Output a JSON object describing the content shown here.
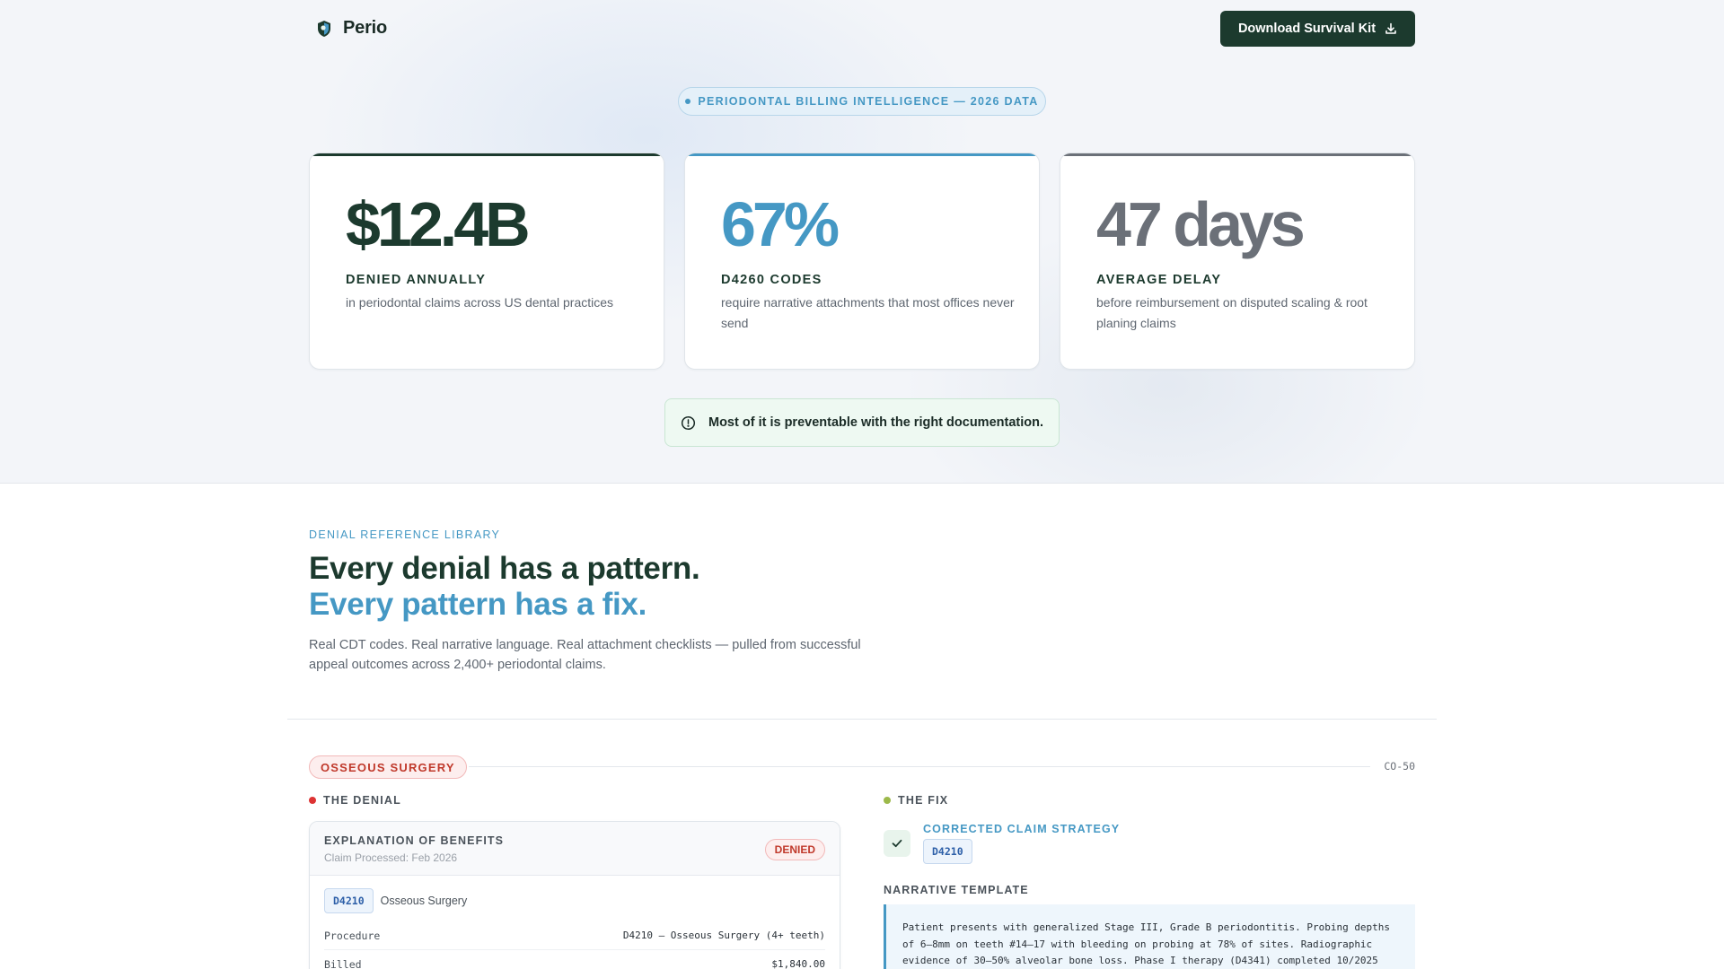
{
  "nav": {
    "brand": "Perio",
    "cta_label": "Download Survival Kit"
  },
  "hero": {
    "pill": "PERIODONTAL BILLING INTELLIGENCE — 2026 DATA",
    "stats": [
      {
        "value": "$12.4B",
        "label": "DENIED ANNUALLY",
        "desc": "in periodontal claims across US dental practices"
      },
      {
        "value": "67%",
        "label": "D4260 CODES",
        "desc": "require narrative attachments that most offices never send"
      },
      {
        "value": "47 days",
        "label": "AVERAGE DELAY",
        "desc": "before reimbursement on disputed scaling & root planing claims"
      }
    ],
    "note": "Most of it is preventable with the right documentation."
  },
  "library": {
    "eyebrow": "DENIAL REFERENCE LIBRARY",
    "headline_1": "Every denial has a pattern.",
    "headline_2": "Every pattern has a fix.",
    "desc": "Real CDT codes. Real narrative language. Real attachment checklists — pulled from successful appeal outcomes across 2,400+ periodontal claims."
  },
  "case": {
    "tag": "OSSEOUS SURGERY",
    "reason_code": "CO-50",
    "denial_heading": "THE DENIAL",
    "fix_heading": "THE FIX",
    "eob": {
      "title": "EXPLANATION OF BENEFITS",
      "processed": "Claim Processed: Feb 2026",
      "status": "DENIED",
      "code": "D4210",
      "code_desc": "Osseous Surgery",
      "rows": [
        {
          "k": "Procedure",
          "v": "D4210 — Osseous Surgery (4+ teeth)"
        },
        {
          "k": "Billed",
          "v": "$1,840.00"
        }
      ]
    },
    "fix": {
      "strategy_title": "CORRECTED CLAIM STRATEGY",
      "code": "D4210",
      "narrative_label": "NARRATIVE TEMPLATE",
      "narrative": "Patient presents with generalized Stage III, Grade B periodontitis. Probing depths of 6–8mm on teeth #14–17 with bleeding on probing at 78% of sites. Radiographic evidence of 30–50% alveolar bone loss. Phase I therapy (D4341) completed 10/2025"
    }
  },
  "colors": {
    "brand_dark": "#1c3a2e",
    "accent_blue": "#4598c4",
    "neutral_gray": "#6b7078",
    "danger": "#c0392b",
    "success_dot": "#9cb94a"
  }
}
